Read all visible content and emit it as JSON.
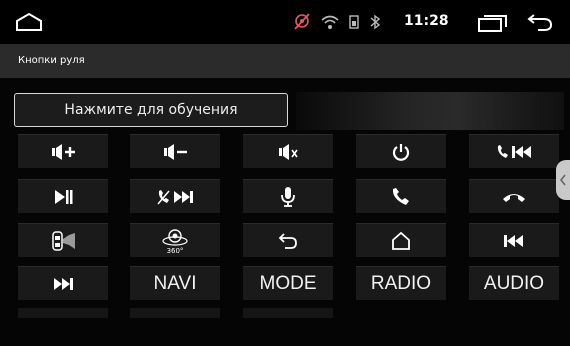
{
  "status_bar": {
    "time": "11:28",
    "icons": [
      "home-icon",
      "gps-off-icon",
      "wifi-icon",
      "sim-icon",
      "bluetooth-icon",
      "recent-apps-icon",
      "back-icon"
    ]
  },
  "header": {
    "title": "Кнопки руля"
  },
  "learn_button": {
    "label": "Нажмите для обучения"
  },
  "keys": {
    "row1": [
      "volume-up-icon",
      "volume-down-icon",
      "mute-icon",
      "power-icon",
      "call-prev-icon"
    ],
    "row2": [
      "play-pause-icon",
      "hangup-next-icon",
      "microphone-icon",
      "call-icon",
      "hang-up-icon"
    ],
    "row3": [
      "car-speaker-icon",
      "camera-360-icon",
      "return-icon",
      "home-icon",
      "previous-track-icon"
    ],
    "row4": {
      "next_icon": "next-track-icon",
      "navi": "NAVI",
      "mode": "MODE",
      "radio": "RADIO",
      "audio": "AUDIO"
    }
  },
  "colors": {
    "background": "#000000",
    "title_bar": "#2b2b2b",
    "key_bg": "#1a1a1a",
    "text": "#ffffff"
  },
  "icons_360_label": "360°"
}
